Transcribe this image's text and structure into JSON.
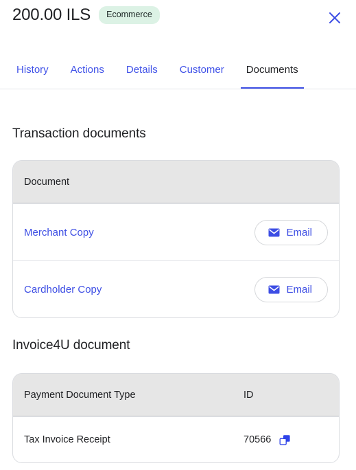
{
  "header": {
    "amount": "200.00 ILS",
    "badge": "Ecommerce",
    "badge_color": "#dcf2e5",
    "close_icon": "close-icon"
  },
  "tabs": [
    {
      "label": "History",
      "active": false
    },
    {
      "label": "Actions",
      "active": false
    },
    {
      "label": "Details",
      "active": false
    },
    {
      "label": "Customer",
      "active": false
    },
    {
      "label": "Documents",
      "active": true
    }
  ],
  "accent_color": "#3d4ee4",
  "transaction_section": {
    "title": "Transaction documents",
    "columns": [
      "Document"
    ],
    "rows": [
      {
        "document": "Merchant Copy",
        "action_label": "Email",
        "action_icon": "envelope-icon"
      },
      {
        "document": "Cardholder Copy",
        "action_label": "Email",
        "action_icon": "envelope-icon"
      }
    ]
  },
  "invoice_section": {
    "title": "Invoice4U document",
    "columns": [
      "Payment Document Type",
      "ID"
    ],
    "rows": [
      {
        "type": "Tax Invoice Receipt",
        "id": "70566",
        "copy_icon": "copy-icon"
      }
    ]
  }
}
